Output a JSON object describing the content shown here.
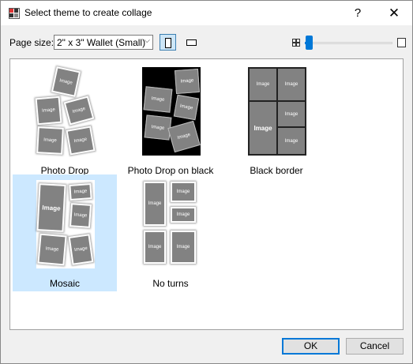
{
  "window": {
    "title": "Select theme to create collage",
    "help_glyph": "?",
    "close_glyph": "✕"
  },
  "toolbar": {
    "page_size_label": "Page size:",
    "page_size_value": "2\" x 3\" Wallet (Small)",
    "orientation_selected": "portrait",
    "zoom_level_fraction": 0.0
  },
  "gallery": {
    "themes": [
      {
        "label": "Photo Drop",
        "selected": false
      },
      {
        "label": "Photo Drop on black",
        "selected": false
      },
      {
        "label": "Black border",
        "selected": false
      },
      {
        "label": "Mosaic",
        "selected": true
      },
      {
        "label": "No turns",
        "selected": false
      }
    ],
    "placeholder_text": "Image"
  },
  "buttons": {
    "ok": "OK",
    "cancel": "Cancel"
  },
  "icons": {
    "app": "collage-app-icon",
    "help": "help-icon",
    "close": "close-icon",
    "portrait": "portrait-orientation-icon",
    "landscape": "landscape-orientation-icon",
    "zoom_small": "small-thumbnails-icon",
    "zoom_large": "large-thumbnail-icon",
    "dropdown": "chevron-down-icon"
  },
  "colors": {
    "selection": "#cce8ff",
    "accent": "#0078d7",
    "placeholder": "#828282"
  }
}
